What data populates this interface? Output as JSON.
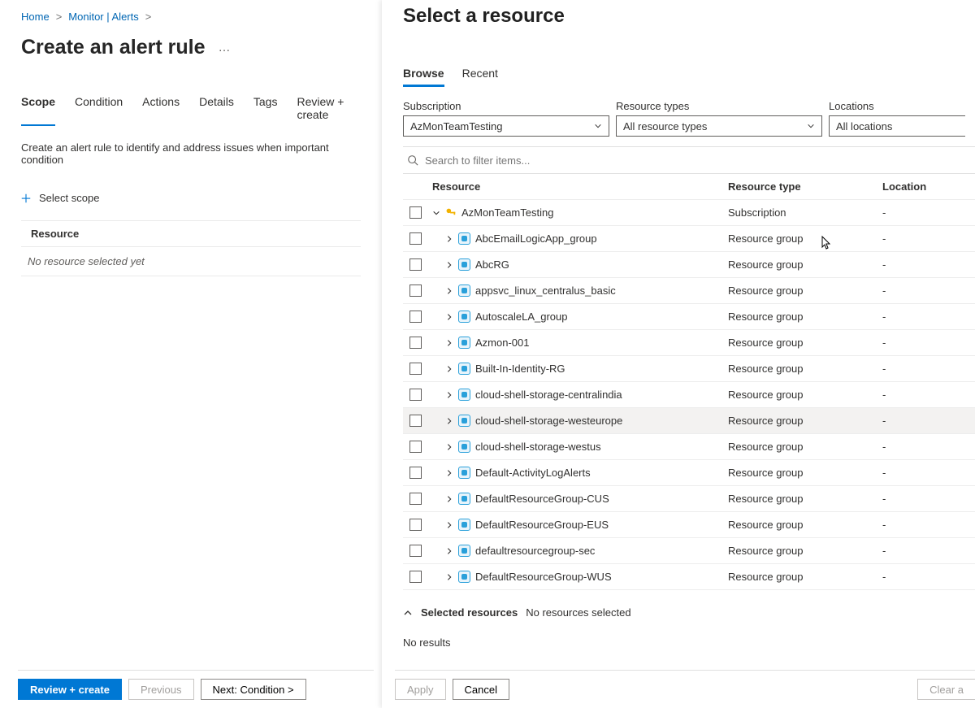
{
  "breadcrumb": {
    "home": "Home",
    "monitor": "Monitor | Alerts"
  },
  "page_title": "Create an alert rule",
  "tabs": {
    "scope": "Scope",
    "condition": "Condition",
    "actions": "Actions",
    "details": "Details",
    "tags": "Tags",
    "review": "Review + create"
  },
  "intro": "Create an alert rule to identify and address issues when important condition",
  "select_scope": "Select scope",
  "resource_header": "Resource",
  "resource_empty": "No resource selected yet",
  "footer_left": {
    "review": "Review + create",
    "previous": "Previous",
    "next": "Next: Condition >"
  },
  "panel": {
    "title": "Select a resource",
    "tabs": {
      "browse": "Browse",
      "recent": "Recent"
    },
    "filters": {
      "subscription_label": "Subscription",
      "subscription_value": "AzMonTeamTesting",
      "type_label": "Resource types",
      "type_value": "All resource types",
      "location_label": "Locations",
      "location_value": "All locations"
    },
    "search_placeholder": "Search to filter items...",
    "grid_header": {
      "resource": "Resource",
      "type": "Resource type",
      "location": "Location"
    },
    "rows": [
      {
        "name": "AzMonTeamTesting",
        "type": "Subscription",
        "location": "-",
        "level": 0,
        "icon": "key",
        "expanded": true
      },
      {
        "name": "AbcEmailLogicApp_group",
        "type": "Resource group",
        "location": "-",
        "level": 1,
        "icon": "rg"
      },
      {
        "name": "AbcRG",
        "type": "Resource group",
        "location": "-",
        "level": 1,
        "icon": "rg"
      },
      {
        "name": "appsvc_linux_centralus_basic",
        "type": "Resource group",
        "location": "-",
        "level": 1,
        "icon": "rg"
      },
      {
        "name": "AutoscaleLA_group",
        "type": "Resource group",
        "location": "-",
        "level": 1,
        "icon": "rg"
      },
      {
        "name": "Azmon-001",
        "type": "Resource group",
        "location": "-",
        "level": 1,
        "icon": "rg"
      },
      {
        "name": "Built-In-Identity-RG",
        "type": "Resource group",
        "location": "-",
        "level": 1,
        "icon": "rg"
      },
      {
        "name": "cloud-shell-storage-centralindia",
        "type": "Resource group",
        "location": "-",
        "level": 1,
        "icon": "rg"
      },
      {
        "name": "cloud-shell-storage-westeurope",
        "type": "Resource group",
        "location": "-",
        "level": 1,
        "icon": "rg",
        "hover": true
      },
      {
        "name": "cloud-shell-storage-westus",
        "type": "Resource group",
        "location": "-",
        "level": 1,
        "icon": "rg"
      },
      {
        "name": "Default-ActivityLogAlerts",
        "type": "Resource group",
        "location": "-",
        "level": 1,
        "icon": "rg"
      },
      {
        "name": "DefaultResourceGroup-CUS",
        "type": "Resource group",
        "location": "-",
        "level": 1,
        "icon": "rg"
      },
      {
        "name": "DefaultResourceGroup-EUS",
        "type": "Resource group",
        "location": "-",
        "level": 1,
        "icon": "rg"
      },
      {
        "name": "defaultresourcegroup-sec",
        "type": "Resource group",
        "location": "-",
        "level": 1,
        "icon": "rg"
      },
      {
        "name": "DefaultResourceGroup-WUS",
        "type": "Resource group",
        "location": "-",
        "level": 1,
        "icon": "rg"
      }
    ],
    "selected_label": "Selected resources",
    "selected_none": "No resources selected",
    "no_results": "No results",
    "footer": {
      "apply": "Apply",
      "cancel": "Cancel",
      "clear": "Clear a"
    }
  }
}
